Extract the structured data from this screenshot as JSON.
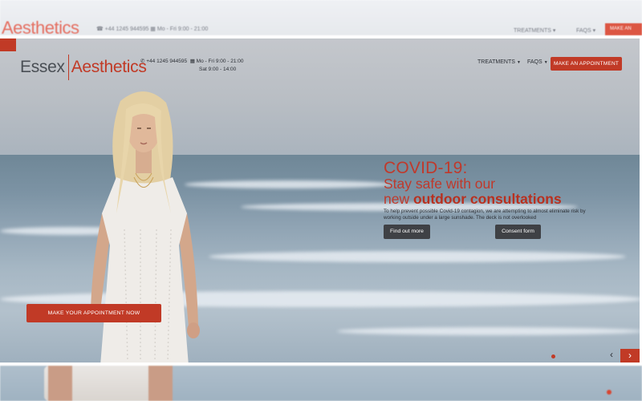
{
  "colors": {
    "accent": "#c13a26",
    "dark_button": "#3f4145",
    "text": "#2b2f35"
  },
  "brand": {
    "word1": "Essex",
    "word2": "Aesthetics"
  },
  "contact": {
    "phone_icon": "phone-icon",
    "phone": "+44 1245 944595",
    "calendar_icon": "calendar-icon",
    "hours_weekday": "Mo - Fri   9:00 - 21:00",
    "hours_sat": "Sat   9:00 - 14:00"
  },
  "nav": {
    "treatments": "TREATMENTS",
    "faqs": "FAQS",
    "appointment": "MAKE AN APPOINTMENT"
  },
  "hero": {
    "title": "COVID-19:",
    "subtitle_line1": "Stay safe with our",
    "subtitle_line2_prefix": "new ",
    "subtitle_line2_bold": "outdoor consultations",
    "body": "To help prevent possible Covid-19 contagion, we are attempting to almost eliminate risk by working outside under a large sunshade. The deck is not overlooked",
    "find_out_more": "Find out more",
    "consent_form": "Consent form",
    "cta": "MAKE YOUR APPOINTMENT NOW"
  },
  "carousel": {
    "prev_icon": "chevron-left-icon",
    "next_icon": "chevron-right-icon"
  }
}
